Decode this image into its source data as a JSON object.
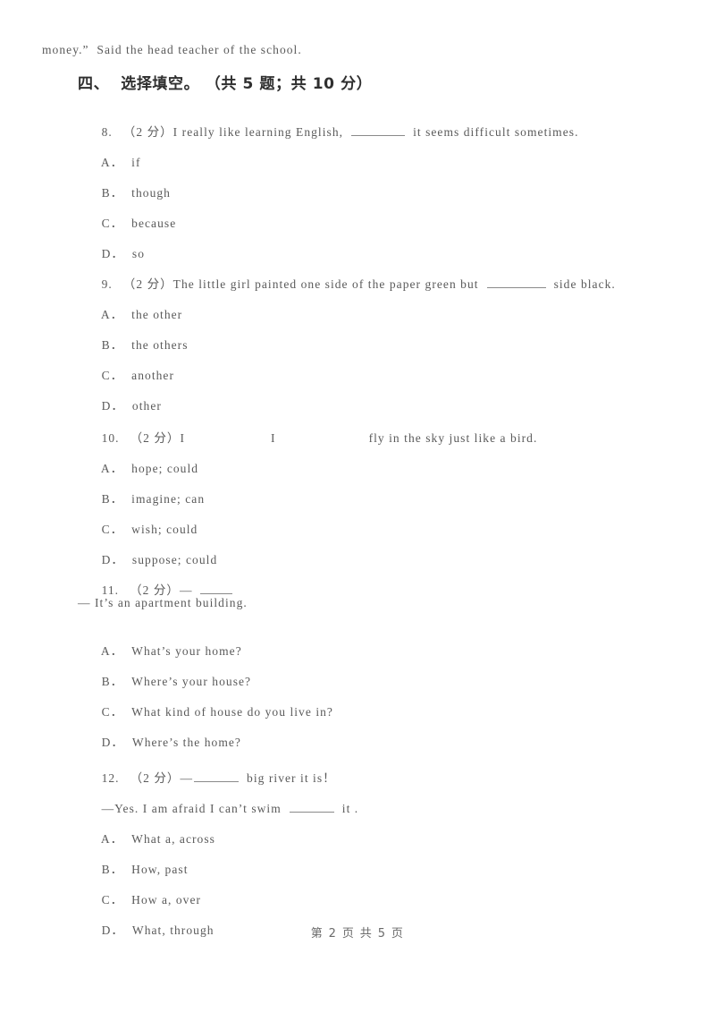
{
  "document": {
    "continuation_text": "money.”  Said the head teacher of the school.",
    "footer": "第 2 页 共 5 页"
  },
  "section": {
    "heading": "四、  选择填空。 （共 5 题；共 10 分）"
  },
  "questions": [
    {
      "number": "8.",
      "marks": "（2 分）",
      "stem_before": "I really like learning English,",
      "stem_after": "it seems difficult sometimes.",
      "options": [
        {
          "letter": "A．",
          "text": "if"
        },
        {
          "letter": "B．",
          "text": "though"
        },
        {
          "letter": "C．",
          "text": "because"
        },
        {
          "letter": "D．",
          "text": "so"
        }
      ]
    },
    {
      "number": "9.",
      "marks": "（2 分）",
      "stem_before": "The little girl painted one side of the paper green but",
      "stem_after": "side black.",
      "options": [
        {
          "letter": "A．",
          "text": "the other"
        },
        {
          "letter": "B．",
          "text": "the others"
        },
        {
          "letter": "C．",
          "text": "another"
        },
        {
          "letter": "D．",
          "text": "other"
        }
      ]
    },
    {
      "number": "10.",
      "marks": "（2 分）",
      "stem_part1": "I",
      "stem_part2": "I",
      "stem_part3": "fly in the sky just like a bird.",
      "options": [
        {
          "letter": "A．",
          "text": "hope; could"
        },
        {
          "letter": "B．",
          "text": "imagine; can"
        },
        {
          "letter": "C．",
          "text": "wish; could"
        },
        {
          "letter": "D．",
          "text": "suppose; could"
        }
      ]
    },
    {
      "number": "11.",
      "marks": "（2 分）",
      "stem_before": "—",
      "stem_after": "",
      "second_line": "— It’s an apartment building.",
      "options": [
        {
          "letter": "A．",
          "text": "What’s your home?"
        },
        {
          "letter": "B．",
          "text": "Where’s your house?"
        },
        {
          "letter": "C．",
          "text": "What kind of house do you live in?"
        },
        {
          "letter": "D．",
          "text": "Where’s the home?"
        }
      ]
    },
    {
      "number": "12.",
      "marks": "（2 分）",
      "stem_before": "—",
      "stem_after": "big river it is！",
      "second_line_before": "—Yes. I am afraid I can’t swim",
      "second_line_after": "it .",
      "options": [
        {
          "letter": "A．",
          "text": "What a, across"
        },
        {
          "letter": "B．",
          "text": "How, past"
        },
        {
          "letter": "C．",
          "text": "How a, over"
        },
        {
          "letter": "D．",
          "text": "What, through"
        }
      ]
    }
  ]
}
